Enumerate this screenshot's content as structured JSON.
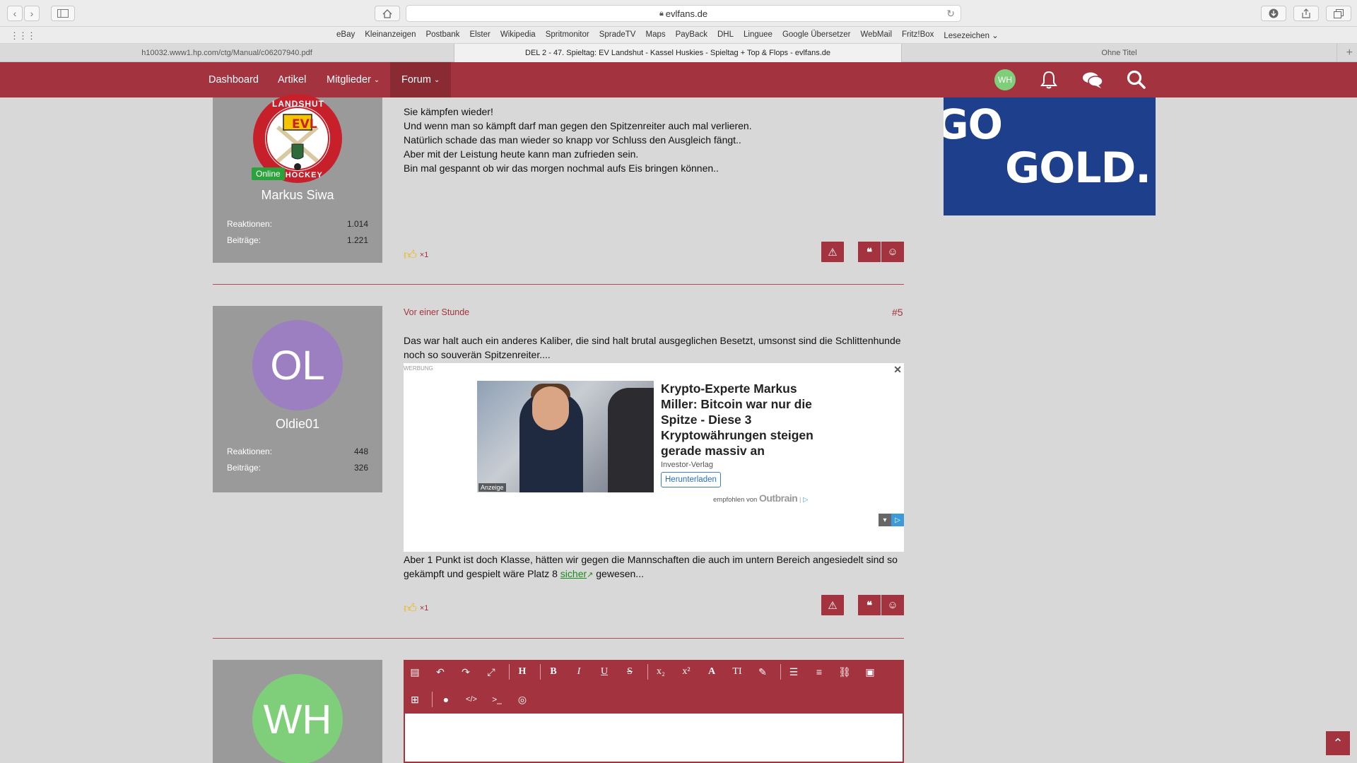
{
  "browser": {
    "url": "evlfans.de",
    "favorites": [
      "eBay",
      "Kleinanzeigen",
      "Postbank",
      "Elster",
      "Wikipedia",
      "Spritmonitor",
      "SpradeTV",
      "Maps",
      "PayBack",
      "DHL",
      "Linguee",
      "Google Übersetzer",
      "WebMail",
      "Fritz!Box",
      "Lesezeichen ⌄"
    ],
    "tabs": [
      {
        "label": "h10032.www1.hp.com/ctg/Manual/c06207940.pdf",
        "active": false
      },
      {
        "label": "DEL 2 - 47. Spieltag: EV Landshut - Kassel Huskies - Spieltag + Top & Flops - evlfans.de",
        "active": true
      },
      {
        "label": "Ohne Titel",
        "active": false
      }
    ]
  },
  "nav": {
    "items": [
      "Dashboard",
      "Artikel",
      "Mitglieder",
      "Forum"
    ],
    "user_initials": "WH"
  },
  "banner": {
    "line1": "GO",
    "line2": "GOLD."
  },
  "post1": {
    "user": "Markus Siwa",
    "online": "Online",
    "logo_text_top": "LANDSHUT",
    "logo_text_mid": "EVL",
    "logo_text_bottom": "EISHOCKEY",
    "reactions_label": "Reaktionen:",
    "reactions": "1.014",
    "posts_label": "Beiträge:",
    "posts": "1.221",
    "lines": [
      "Sie kämpfen wieder!",
      "Und wenn man so kämpft darf man gegen den Spitzenreiter auch mal verlieren.",
      "Natürlich schade das man wieder so knapp vor Schluss den Ausgleich fängt..",
      "Aber mit der Leistung heute kann man zufrieden sein.",
      "Bin mal gespannt ob wir das morgen nochmal aufs Eis bringen können.."
    ],
    "likes": "×1"
  },
  "post2": {
    "user": "Oldie01",
    "initials": "OL",
    "reactions_label": "Reaktionen:",
    "reactions": "448",
    "posts_label": "Beiträge:",
    "posts": "326",
    "date": "Vor einer Stunde",
    "number": "#5",
    "line1": "Das war halt auch ein anderes Kaliber, die sind halt brutal ausgeglichen Besetzt, umsonst sind die Schlittenhunde",
    "line2": "noch so souverän Spitzenreiter....",
    "after1": "Aber 1 Punkt ist doch Klasse, hätten wir gegen die Mannschaften die auch im untern Bereich angesiedelt sind so",
    "after2_a": "gekämpft und gespielt wäre Platz 8 ",
    "after2_link": "sicher",
    "after2_b": " gewesen...",
    "likes": "×1"
  },
  "ad": {
    "label": "WERBUNG",
    "title": "Krypto-Experte Markus Miller: Bitcoin war nur die Spitze - Diese 3 Kryptowährungen steigen gerade massiv an",
    "source": "Investor-Verlag",
    "button": "Herunterladen",
    "badge": "Anzeige",
    "recommended": "empfohlen von",
    "brand": "Outbrain"
  },
  "reply": {
    "initials": "WH"
  },
  "colors": {
    "brand": "#a3333e",
    "online": "#2aa33a"
  }
}
